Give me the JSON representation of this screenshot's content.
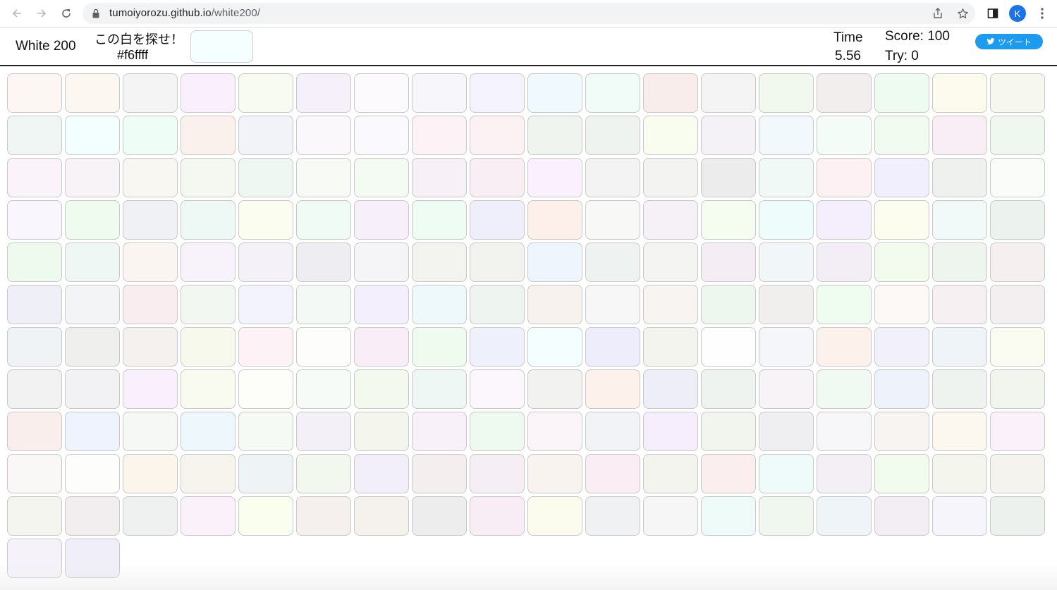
{
  "browser": {
    "url_host": "tumoiyorozu.github.io",
    "url_path": "/white200/",
    "profile_initial": "K"
  },
  "header": {
    "title": "White 200",
    "prompt": "この白を探せ！",
    "target_hex": "#f6ffff",
    "target_color": "#f6ffff",
    "time_label": "Time",
    "time_value": "5.56",
    "score_text": "Score: 100",
    "try_text": "Try: 0",
    "tweet_label": "ツイート"
  },
  "cells": [
    "#fdf7f3",
    "#fdf7f2",
    "#f3f4f3",
    "#faf0fd",
    "#f7fbf2",
    "#f6f0fa",
    "#fcfafd",
    "#f7f7fb",
    "#f5f3fd",
    "#f0f9fd",
    "#f1fcf8",
    "#f9edeb",
    "#f4f4f4",
    "#f1f9ee",
    "#f2eeee",
    "#eefbf1",
    "#fdfbee",
    "#f6f8f0",
    "#eff6f3",
    "#f2fffe",
    "#eefdf5",
    "#faf1ec",
    "#f2f2f9",
    "#fbf8fb",
    "#f9f9fe",
    "#fdf2f6",
    "#fdf2f3",
    "#f0f4ee",
    "#eff3ef",
    "#f9fdef",
    "#f4f1f7",
    "#f2f9fd",
    "#f3fcf6",
    "#f1fbf0",
    "#f9eef6",
    "#eff8ee",
    "#faf3fa",
    "#f7f3f7",
    "#f8f7f1",
    "#f5f7f1",
    "#eef7f1",
    "#f8faf6",
    "#f3fbf2",
    "#f7f1f7",
    "#f9eef4",
    "#fbf0fd",
    "#f3f3f3",
    "#f3f4f2",
    "#ececec",
    "#f1f9f6",
    "#fdf1f4",
    "#f1eefd",
    "#eef1ee",
    "#fafcfa",
    "#faf6fd",
    "#f0fbf0",
    "#eff1f4",
    "#eef8f4",
    "#fbfdf1",
    "#f1fbf5",
    "#f7f0fa",
    "#eefcf3",
    "#efeefb",
    "#fdf0ea",
    "#f8f8f6",
    "#f6f1f6",
    "#f5fcf0",
    "#effcfc",
    "#f5effd",
    "#fcfdef",
    "#f2f9f9",
    "#ecf3ee",
    "#effaef",
    "#eff7f4",
    "#fbf5f1",
    "#f8f3fa",
    "#f4f2f8",
    "#eeeef2",
    "#f5f4f7",
    "#f3f3f0",
    "#f2f3ee",
    "#eef5fd",
    "#eef3f1",
    "#f4f4f3",
    "#f4eef4",
    "#f1f7f9",
    "#f3eef5",
    "#f3faee",
    "#eef4ee",
    "#f5eff0",
    "#eeeff7",
    "#f3f4f6",
    "#f9edf0",
    "#f2f8f1",
    "#f3f3fd",
    "#f3faf6",
    "#f4effc",
    "#eef9fb",
    "#eef4ef",
    "#f8f2ee",
    "#f7f7f8",
    "#f7f4f1",
    "#eef7ee",
    "#f0efee",
    "#eefdef",
    "#fdf9f6",
    "#f6f0f2",
    "#f3eff1",
    "#eff3f6",
    "#eff0ee",
    "#f4f1ee",
    "#f8f9ed",
    "#fdf3f6",
    "#fdfdfc",
    "#f9edf7",
    "#eefbee",
    "#eef0fb",
    "#f5fefe",
    "#eeedfb",
    "#f3f4ee",
    "#fefefe",
    "#f5f6fa",
    "#fcf2eb",
    "#f1f0fb",
    "#eef4f7",
    "#fbfcf1",
    "#f2f2f2",
    "#f2f2f5",
    "#f9effd",
    "#f9fbf1",
    "#fdfefa",
    "#f7fbf8",
    "#f3f9ee",
    "#eff7f4",
    "#fcf7fd",
    "#f2f2f1",
    "#fdf1ec",
    "#eeeef8",
    "#eff3ef",
    "#f7f3f7",
    "#f1f9f3",
    "#eef2fb",
    "#eff3ef",
    "#f2f5ed",
    "#faeeed",
    "#eef3fd",
    "#f6f8f6",
    "#eef7fb",
    "#f5fbf4",
    "#f3f0f8",
    "#f4f6ed",
    "#f9f1f9",
    "#eef9ef",
    "#fbf4f8",
    "#f2f3f6",
    "#f6eefc",
    "#f1f5ee",
    "#efeef1",
    "#f7f7fa",
    "#f8f4f2",
    "#fcf8ef",
    "#faf1fa",
    "#f9f8f7",
    "#fdfefc",
    "#fcf5ec",
    "#f6f4ed",
    "#eef3f6",
    "#f3f8ee",
    "#f2eefa",
    "#f5eeee",
    "#f5eff5",
    "#f9f3ef",
    "#faeef4",
    "#f3f4ee",
    "#fbeeee",
    "#effbfb",
    "#f4eff5",
    "#f1fbee",
    "#f4f5ec",
    "#f5f3ee",
    "#f4f5ee",
    "#f2edef",
    "#eff0f0",
    "#fbf1fb",
    "#fafeee",
    "#f5f0ee",
    "#f5f2ee",
    "#ededee",
    "#f8edf4",
    "#fcfcee",
    "#eff1f3",
    "#f6f6f6",
    "#effbf9",
    "#eff7ee",
    "#eff4f9",
    "#f3eef3",
    "#f7f5fc",
    "#edf1ee",
    "#f5f3f9",
    "#f0eef8"
  ]
}
